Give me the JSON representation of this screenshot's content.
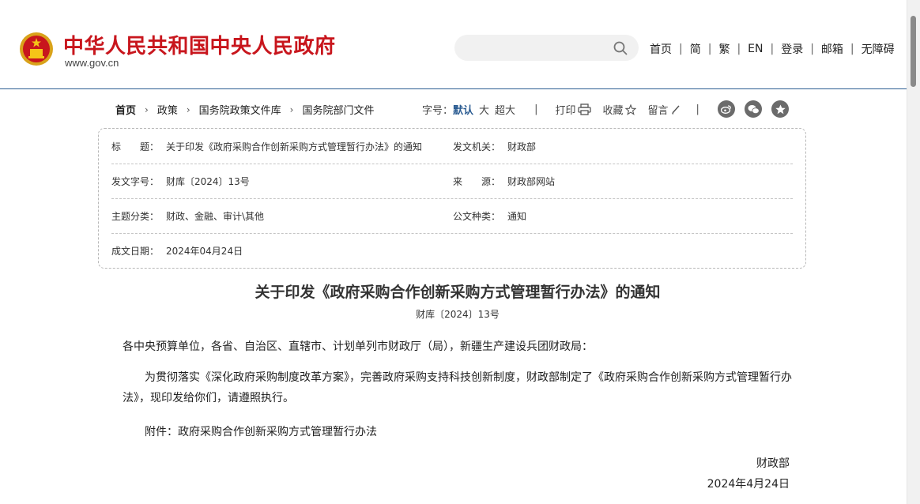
{
  "header": {
    "site_title": "中华人民共和国中央人民政府",
    "site_url": "www.gov.cn",
    "search_placeholder": "",
    "nav": [
      "首页",
      "简",
      "繁",
      "EN",
      "登录",
      "邮箱",
      "无障碍"
    ],
    "brand_color": "#c8161d"
  },
  "breadcrumb": [
    "首页",
    "政策",
    "国务院政策文件库",
    "国务院部门文件"
  ],
  "toolbar": {
    "font_label": "字号：",
    "font_options": [
      "默认",
      "大",
      "超大"
    ],
    "print_label": "打印",
    "favorite_label": "收藏",
    "comment_label": "留言",
    "share_icons": [
      "weibo-icon",
      "wechat-icon",
      "qzone-icon"
    ]
  },
  "meta": {
    "title_label": "标　　题：",
    "title_value": "关于印发《政府采购合作创新采购方式管理暂行办法》的通知",
    "issuer_label": "发文机关：",
    "issuer_value": "财政部",
    "docno_label": "发文字号：",
    "docno_value": "财库〔2024〕13号",
    "source_label": "来　　源：",
    "source_value": "财政部网站",
    "topic_label": "主题分类：",
    "topic_value": "财政、金融、审计\\其他",
    "type_label": "公文种类：",
    "type_value": "通知",
    "date_label": "成文日期：",
    "date_value": "2024年04月24日"
  },
  "document": {
    "title": "关于印发《政府采购合作创新采购方式管理暂行办法》的通知",
    "number": "财库〔2024〕13号",
    "salutation": "各中央预算单位，各省、自治区、直辖市、计划单列市财政厅（局），新疆生产建设兵团财政局：",
    "body": "为贯彻落实《深化政府采购制度改革方案》，完善政府采购支持科技创新制度，财政部制定了《政府采购合作创新采购方式管理暂行办法》，现印发给你们，请遵照执行。",
    "attachment": "附件：政府采购合作创新采购方式管理暂行办法",
    "signature": "财政部",
    "sign_date": "2024年4月24日"
  }
}
